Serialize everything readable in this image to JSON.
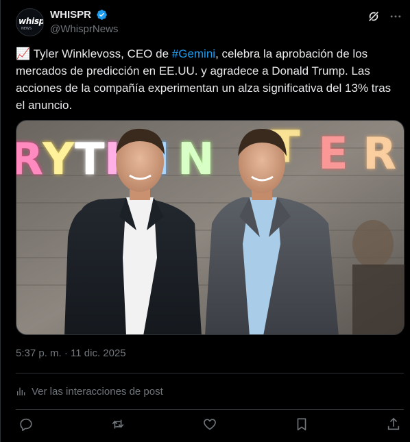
{
  "post": {
    "author": {
      "display_name": "WHISPR",
      "handle": "@WhisprNews",
      "avatar_text": "whispr",
      "avatar_sub": "NEWS",
      "verified": true
    },
    "text": {
      "emoji": "📈",
      "part1": "Tyler Winklevoss, CEO de ",
      "hashtag": "#Gemini",
      "part2": ", celebra la aprobación de los mercados de predicción en EE.UU. y agradece a Donald Trump. Las acciones de la compañía experimentan un alza significativa del 13% tras el anuncio."
    },
    "media": {
      "neon_sign": "RYTHIN"
    },
    "timestamp": "5:37 p. m. · 11 dic. 2025",
    "insights_label": "Ver las interacciones de post",
    "actions": [
      "reply-icon",
      "repost-icon",
      "like-icon",
      "bookmark-icon",
      "share-icon"
    ]
  },
  "colors": {
    "background": "#000000",
    "text": "#e7e9ea",
    "secondary": "#71767b",
    "accent": "#1d9bf0",
    "divider": "#2f3336"
  }
}
